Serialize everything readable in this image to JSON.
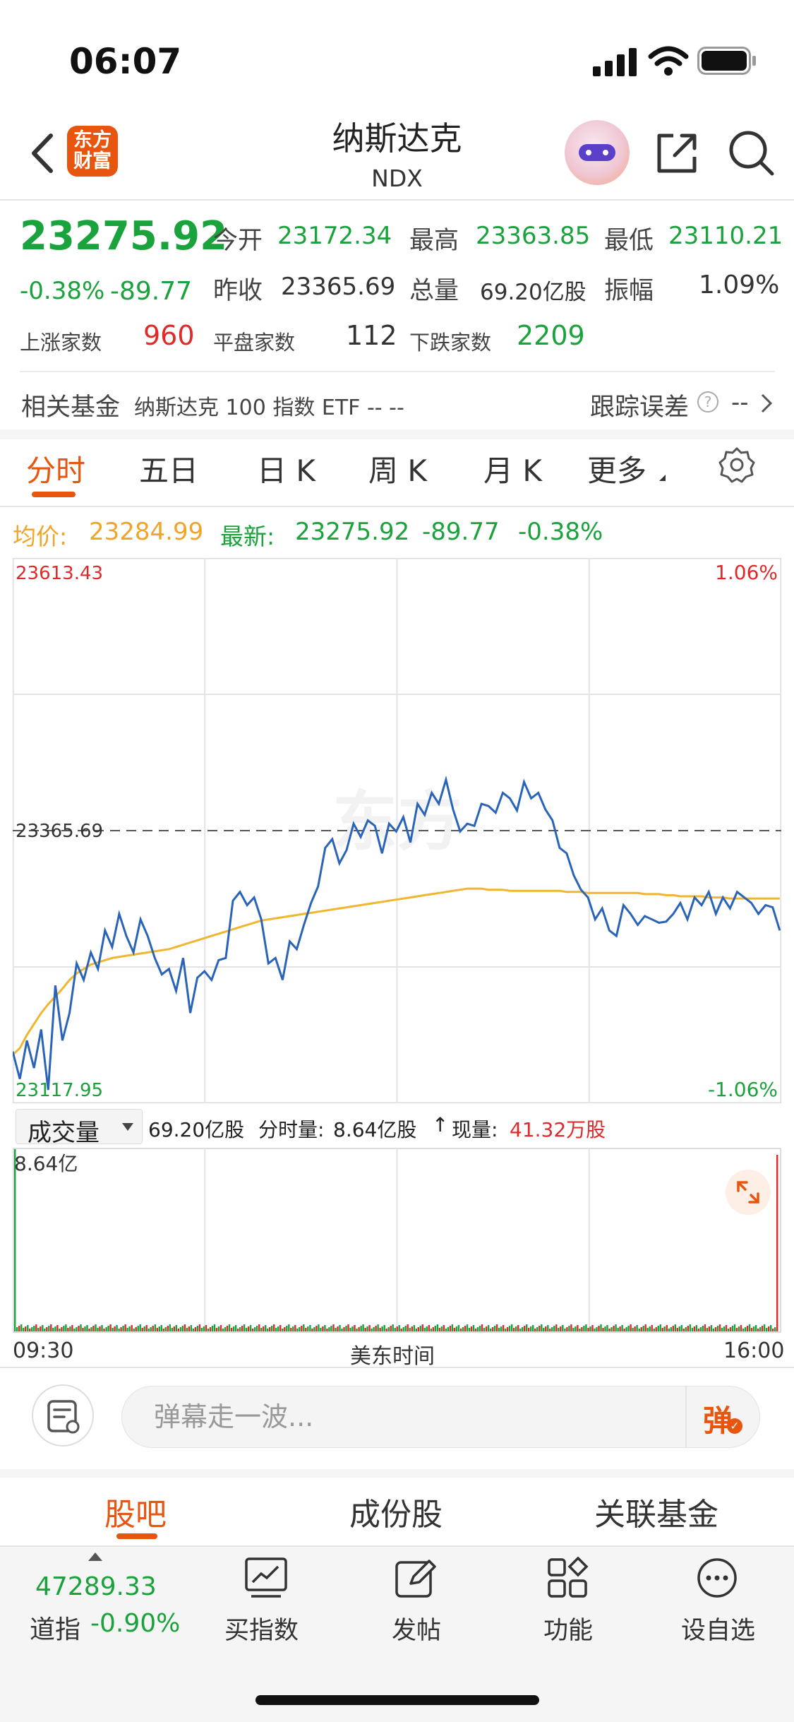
{
  "status_bar": {
    "time": "06:07"
  },
  "header": {
    "title": "纳斯达克",
    "subtitle": "NDX",
    "logo_line1": "东方",
    "logo_line2": "财富"
  },
  "quote": {
    "price": "23275.92",
    "change_pct": "-0.38%",
    "change": "-89.77",
    "open_label": "今开",
    "open": "23172.34",
    "high_label": "最高",
    "high": "23363.85",
    "low_label": "最低",
    "low": "23110.21",
    "prev_close_label": "昨收",
    "prev_close": "23365.69",
    "volume_label": "总量",
    "volume": "69.20亿股",
    "amplitude_label": "振幅",
    "amplitude": "1.09%",
    "up_label": "上涨家数",
    "up": "960",
    "flat_label": "平盘家数",
    "flat": "112",
    "down_label": "下跌家数",
    "down": "2209"
  },
  "related_fund": {
    "label": "相关基金",
    "name": "纳斯达克 100 指数 ETF -- --",
    "tracking_label": "跟踪误差",
    "tracking_value": "--"
  },
  "tabs": [
    "分时",
    "五日",
    "日 K",
    "周 K",
    "月 K",
    "更多"
  ],
  "chart_info": {
    "avg_label": "均价:",
    "avg_value": "23284.99",
    "latest_label": "最新:",
    "latest_value": "23275.92",
    "latest_change": "-89.77",
    "latest_pct": "-0.38%"
  },
  "volume_info": {
    "selector": "成交量",
    "total": "69.20亿股",
    "period_label": "分时量:",
    "period_value": "8.64亿股",
    "current_label": "现量:",
    "current_value": "41.32万股"
  },
  "chart_data": {
    "type": "line",
    "ylim": [
      23117.95,
      23613.43
    ],
    "y_tick_labels": [
      "23613.43",
      "23365.69",
      "23117.95"
    ],
    "pct_tick_labels": [
      "1.06%",
      "-1.06%"
    ],
    "reference_line": 23365.69,
    "x_tick_labels": [
      "09:30",
      "美东时间",
      "16:00"
    ],
    "volume_max_label": "8.64亿",
    "series": [
      {
        "name": "最新",
        "color": "#2a64b8",
        "values": [
          23165,
          23140,
          23175,
          23150,
          23185,
          23130,
          23225,
          23175,
          23200,
          23245,
          23230,
          23255,
          23240,
          23275,
          23260,
          23290,
          23270,
          23255,
          23285,
          23270,
          23250,
          23235,
          23240,
          23220,
          23250,
          23200,
          23232,
          23238,
          23230,
          23248,
          23250,
          23302,
          23310,
          23298,
          23305,
          23285,
          23245,
          23250,
          23230,
          23265,
          23258,
          23280,
          23300,
          23315,
          23350,
          23358,
          23336,
          23348,
          23372,
          23360,
          23375,
          23370,
          23345,
          23372,
          23365,
          23378,
          23355,
          23390,
          23380,
          23400,
          23390,
          23412,
          23385,
          23365,
          23372,
          23370,
          23390,
          23388,
          23382,
          23400,
          23395,
          23384,
          23410,
          23395,
          23400,
          23385,
          23375,
          23350,
          23345,
          23325,
          23312,
          23305,
          23285,
          23295,
          23275,
          23270,
          23298,
          23290,
          23280,
          23288,
          23285,
          23282,
          23283,
          23290,
          23300,
          23285,
          23305,
          23298,
          23310,
          23290,
          23305,
          23295,
          23310,
          23305,
          23300,
          23290,
          23298,
          23296,
          23275
        ]
      },
      {
        "name": "均价",
        "color": "#f0b630",
        "values": [
          23162,
          23168,
          23180,
          23190,
          23200,
          23208,
          23215,
          23222,
          23230,
          23236,
          23240,
          23244,
          23246,
          23248,
          23250,
          23251,
          23252,
          23253,
          23254,
          23255,
          23256,
          23257,
          23258,
          23260,
          23262,
          23264,
          23266,
          23268,
          23270,
          23272,
          23274,
          23276,
          23278,
          23280,
          23282,
          23284,
          23285,
          23286,
          23287,
          23288,
          23289,
          23290,
          23291,
          23292,
          23293,
          23294,
          23295,
          23296,
          23297,
          23298,
          23299,
          23300,
          23301,
          23302,
          23303,
          23304,
          23305,
          23306,
          23307,
          23308,
          23309,
          23310,
          23311,
          23312,
          23313,
          23313,
          23313,
          23312,
          23312,
          23312,
          23311,
          23311,
          23311,
          23311,
          23311,
          23311,
          23311,
          23311,
          23310,
          23310,
          23310,
          23309,
          23309,
          23309,
          23309,
          23309,
          23309,
          23309,
          23309,
          23308,
          23308,
          23308,
          23307,
          23307,
          23306,
          23306,
          23306,
          23306,
          23305,
          23305,
          23305,
          23304,
          23304,
          23304,
          23304,
          23304,
          23304,
          23304,
          23304
        ]
      }
    ]
  },
  "comment_bar": {
    "placeholder": "弹幕走一波...",
    "send_label": "弹"
  },
  "bottom_tabs": [
    "股吧",
    "成份股",
    "关联基金"
  ],
  "toolbar": {
    "dow_value": "47289.33",
    "dow_label": "道指",
    "dow_pct": "-0.90%",
    "items": [
      "买指数",
      "发帖",
      "功能",
      "设自选"
    ]
  },
  "colors": {
    "accent": "#e8550f",
    "up": "#e02a2a",
    "down": "#1aa23c",
    "line": "#2a64b8",
    "avg": "#f0b630"
  }
}
